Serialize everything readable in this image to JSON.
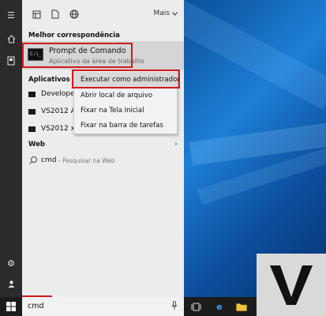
{
  "rail": {
    "icons": [
      "hamburger-icon",
      "home-icon",
      "tablet-icon",
      "settings-icon",
      "user-icon"
    ]
  },
  "topbar": {
    "icons": [
      "apps-grid-icon",
      "document-icon",
      "globe-icon"
    ],
    "more_label": "Mais"
  },
  "sections": {
    "best_match": "Melhor correspondência",
    "apps": "Aplicativos",
    "web": "Web"
  },
  "best_match": {
    "title": "Prompt de Comando",
    "subtitle": "Aplicativo da área de trabalho",
    "thumb_text": "C:\\_"
  },
  "apps": [
    {
      "label": "Developer"
    },
    {
      "label": "VS2012 AR"
    },
    {
      "label": "VS2012 x6"
    }
  ],
  "web": {
    "query": "cmd",
    "subtitle": "- Pesquisar na Web"
  },
  "context_menu": {
    "items": [
      {
        "label": "Executar como administrador",
        "highlighted": true
      },
      {
        "label": "Abrir local de arquivo",
        "highlighted": false
      },
      {
        "label": "Fixar na Tela Inicial",
        "highlighted": false
      },
      {
        "label": "Fixar na barra de tarefas",
        "highlighted": false
      }
    ]
  },
  "taskbar": {
    "search_value": "cmd",
    "icons": [
      "windows-start-icon",
      "microphone-icon",
      "task-view-icon",
      "edge-icon",
      "file-explorer-icon"
    ]
  },
  "watermark": {
    "letter": "V"
  },
  "colors": {
    "highlight_red": "#d11a1a",
    "panel_bg": "#ececec",
    "rail_bg": "#2b2b2b",
    "taskbar_bg": "#1c1c1c",
    "accent_blue": "#1a73d0"
  }
}
